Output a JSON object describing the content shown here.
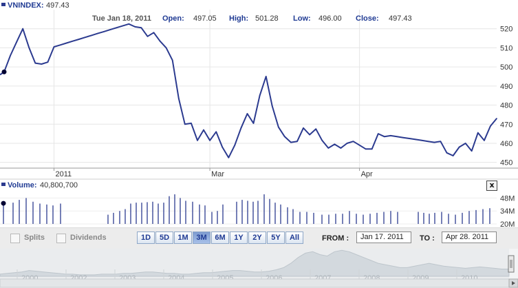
{
  "header": {
    "index_name": "VNINDEX:",
    "index_value": "497.43",
    "date": "Tue Jan 18, 2011",
    "open_label": "Open:",
    "open_value": "497.05",
    "high_label": "High:",
    "high_value": "501.28",
    "low_label": "Low:",
    "low_value": "496.00",
    "close_label": "Close:",
    "close_value": "497.43"
  },
  "volume_header": {
    "label": "Volume:",
    "value": "40,800,700",
    "close_button": "x"
  },
  "controls": {
    "splits_label": "Splits",
    "dividends_label": "Dividends",
    "ranges": [
      "1D",
      "5D",
      "1M",
      "3M",
      "6M",
      "1Y",
      "2Y",
      "5Y",
      "All"
    ],
    "active_range": "3M",
    "from_label": "FROM :",
    "from_value": "Jan 17. 2011",
    "to_label": "TO :",
    "to_value": "Apr 28. 2011"
  },
  "colors": {
    "line": "#2b3a8f",
    "marker": "#000033",
    "grid": "#e6e6e6",
    "navigator_fill": "#d9dfe3",
    "navigator_stroke": "#c0c8ce"
  },
  "chart_data": [
    {
      "type": "line",
      "series": [
        {
          "values": [
            497.4,
            506,
            513,
            520,
            510,
            502,
            501.5,
            502.5,
            510.5,
            511.5,
            512.5,
            513.5,
            514.5,
            515.5,
            516.5,
            517.5,
            518.5,
            519.5,
            520.5,
            521.5,
            522.5,
            521,
            520.5,
            516,
            518,
            513.5,
            510,
            503.5,
            483.5,
            470,
            470.5,
            461.5,
            467,
            461.5,
            466,
            458,
            452.5,
            459,
            468,
            475.5,
            470.5,
            485,
            495,
            479.5,
            468.5,
            463.5,
            460.5,
            461,
            468,
            464.5,
            467.5,
            461.5,
            457.5,
            459.5,
            457.5,
            460,
            461,
            459,
            457,
            457,
            465,
            463.5,
            464,
            463.5,
            463,
            462.5,
            462,
            461.5,
            461,
            460.5,
            461,
            455,
            453.5,
            458,
            460,
            456,
            465.5,
            461.5,
            469,
            473
          ]
        }
      ],
      "y_ticks": [
        450,
        460,
        470,
        480,
        490,
        500,
        510,
        520
      ],
      "ylim": [
        447,
        530
      ],
      "x_labels": [
        {
          "label": "2011",
          "index": 8
        },
        {
          "label": "Mar",
          "index": 33
        },
        {
          "label": "Apr",
          "index": 57
        }
      ],
      "grid": true
    },
    {
      "type": "bar",
      "values": [
        40.8,
        43,
        46,
        48,
        44,
        42,
        41,
        40,
        42,
        30,
        32,
        34,
        36,
        42,
        43,
        43,
        43.5,
        44,
        42,
        43,
        50,
        52,
        48,
        45,
        44,
        41,
        40,
        33,
        34,
        41,
        44,
        46,
        45,
        44,
        45,
        52,
        47,
        43,
        41,
        38,
        36,
        33,
        33,
        32,
        30,
        30,
        31,
        31,
        34,
        31,
        30,
        31,
        32,
        33,
        34,
        33
      ],
      "bar_positions": [
        5,
        19,
        28,
        38,
        48,
        58,
        68,
        77,
        88,
        157,
        165,
        174,
        182,
        190,
        198,
        206,
        214,
        222,
        230,
        238,
        246,
        254,
        262,
        270,
        280,
        290,
        298,
        308,
        316,
        324,
        344,
        352,
        360,
        368,
        375,
        384,
        392,
        400,
        408,
        418,
        426,
        436,
        446,
        456,
        468,
        478,
        488,
        498,
        508,
        518,
        528,
        538,
        548,
        558,
        568,
        578
      ],
      "extra_bars": [
        [
          608,
          33
        ],
        [
          616,
          32
        ],
        [
          624,
          31
        ],
        [
          632,
          32
        ],
        [
          642,
          33
        ],
        [
          652,
          31
        ],
        [
          662,
          30
        ],
        [
          672,
          32
        ],
        [
          682,
          34
        ],
        [
          692,
          35
        ],
        [
          702,
          36
        ],
        [
          712,
          37
        ]
      ],
      "y_ticks": [
        "20M",
        "34M",
        "48M"
      ],
      "ylim": [
        20,
        55
      ]
    },
    {
      "type": "area",
      "x_labels": [
        "2000",
        "2002",
        "2003",
        "2004",
        "2005",
        "2006",
        "2007",
        "2008",
        "2009",
        "2010"
      ],
      "values": [
        3,
        4,
        5,
        6,
        8,
        7,
        6,
        5,
        4,
        3,
        3,
        2,
        2,
        2,
        3,
        3,
        3,
        4,
        4,
        5,
        6,
        6,
        5,
        4,
        4,
        3,
        3,
        4,
        5,
        5,
        6,
        7,
        8,
        8,
        7,
        6,
        6,
        7,
        9,
        12,
        18,
        26,
        32,
        34,
        30,
        28,
        34,
        36,
        34,
        30,
        26,
        22,
        18,
        16,
        14,
        12,
        12,
        14,
        16,
        18,
        16,
        14,
        13,
        12,
        11,
        12,
        13,
        12,
        11,
        10,
        10
      ]
    }
  ]
}
